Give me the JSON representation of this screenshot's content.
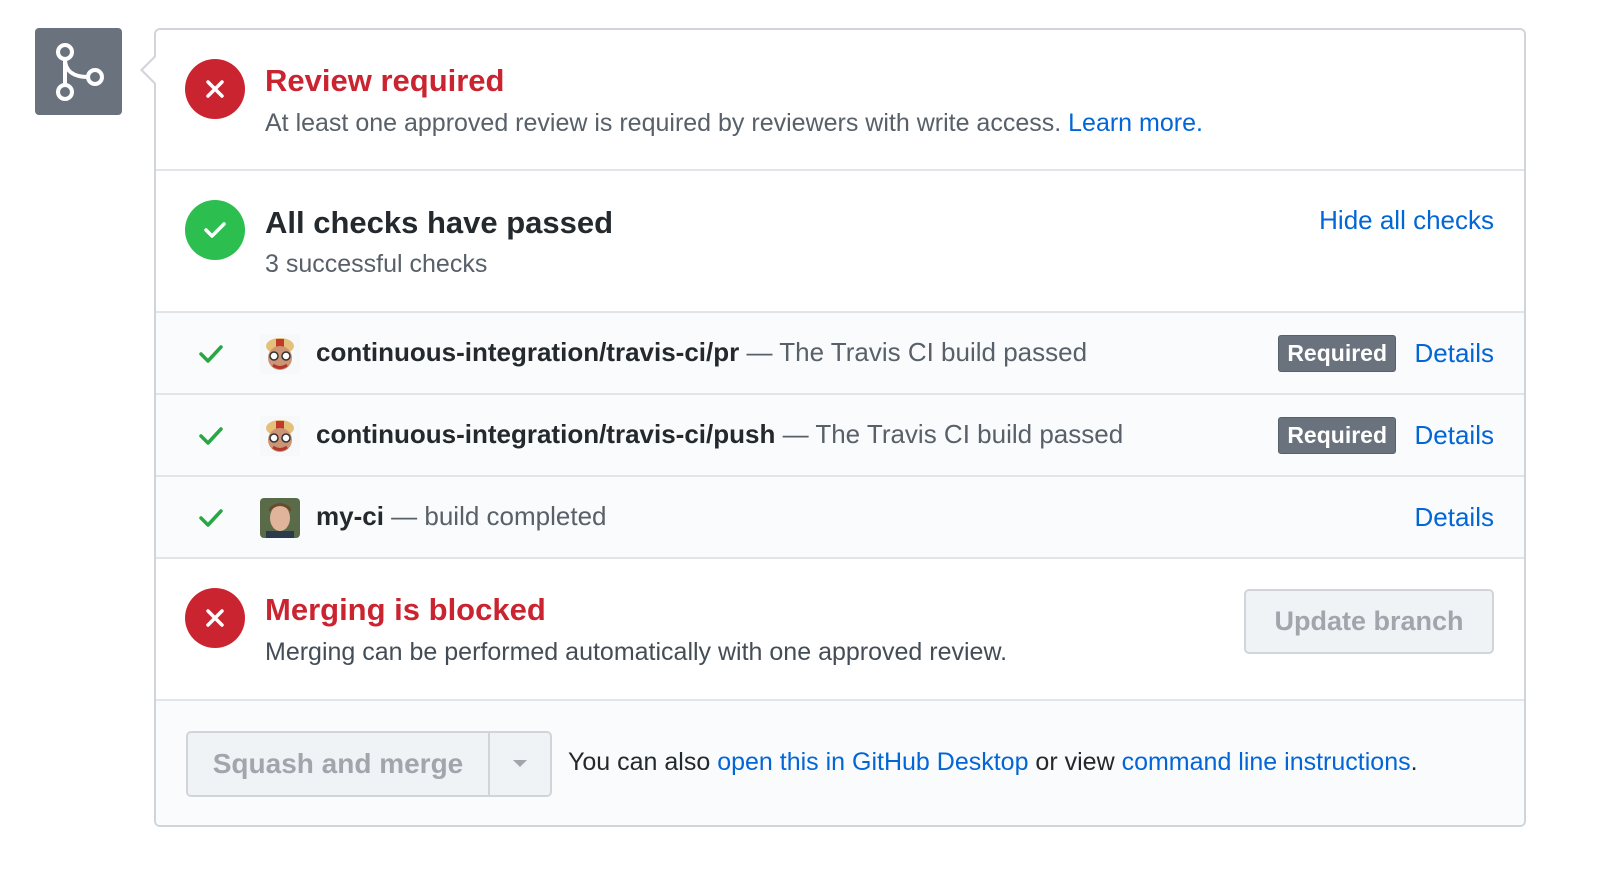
{
  "review": {
    "title": "Review required",
    "description": "At least one approved review is required by reviewers with write access.",
    "learn_more": "Learn more."
  },
  "checks": {
    "title": "All checks have passed",
    "subtitle": "3 successful checks",
    "hide_link": "Hide all checks",
    "items": [
      {
        "name": "continuous-integration/travis-ci/pr",
        "separator": " — ",
        "description": "The Travis CI build passed",
        "badge": "Required",
        "details": "Details"
      },
      {
        "name": "continuous-integration/travis-ci/push",
        "separator": " — ",
        "description": "The Travis CI build passed",
        "badge": "Required",
        "details": "Details"
      },
      {
        "name": "my-ci",
        "separator": " — ",
        "description": "build completed",
        "details": "Details"
      }
    ]
  },
  "blocked": {
    "title": "Merging is blocked",
    "description": "Merging can be performed automatically with one approved review.",
    "update_button": "Update branch"
  },
  "merge": {
    "button_label": "Squash and merge",
    "note_prefix": "You can also ",
    "desktop_link": "open this in GitHub Desktop",
    "note_middle": " or view ",
    "cli_link": "command line instructions",
    "note_suffix": "."
  },
  "colors": {
    "error": "#cb2431",
    "success": "#2cbe4e",
    "link": "#0366d6",
    "badge": "#6a737d"
  }
}
